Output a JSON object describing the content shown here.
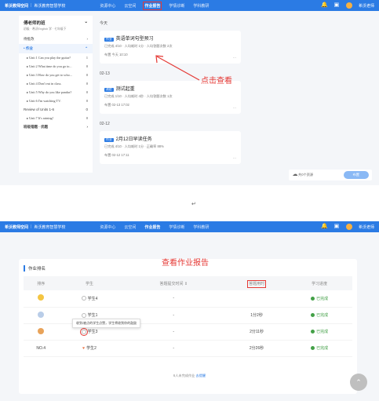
{
  "topbar": {
    "brand": "希沃教师空间",
    "school": "希沃教育智慧学校",
    "nav": [
      "资源中心",
      "云空间",
      "作业报告",
      "学情诊断",
      "学科教研"
    ],
    "user": "希沃老师"
  },
  "sidebar": {
    "title": "傅老师的班",
    "subtitle": "初级 · 希沃English 学 · 七年级下",
    "rows": [
      {
        "label": "待批改",
        "count": "›"
      },
      {
        "label": "作业",
        "count": "⌃"
      },
      {
        "label": "Unit 1 Can you play the guitar?",
        "count": "1"
      },
      {
        "label": "Unit 2 What time do you go to...",
        "count": "0"
      },
      {
        "label": "Unit 3 How do you get to scho...",
        "count": "0"
      },
      {
        "label": "Unit 4 Don't eat in class.",
        "count": "0"
      },
      {
        "label": "Unit 5 Why do you like pandas?",
        "count": "0"
      },
      {
        "label": "Unit 6 I'm watching TV.",
        "count": "0"
      },
      {
        "label": "Review of Units 1-6",
        "count": "0"
      },
      {
        "label": "Unit 7 It's raining!",
        "count": "0"
      },
      {
        "label": "班级错题 · 优题",
        "count": "›"
      }
    ]
  },
  "timeline": [
    {
      "date": "今天",
      "tag": "作业",
      "title": "英语单词句型预习",
      "meta": "已完成 4/10 · 人均耗时 1分 · 人均答题次数 2次",
      "time": "布置 今天 10:10"
    },
    {
      "date": "02-13",
      "tag": "测验",
      "title": "测试起重",
      "meta": "已完成 1/10 · 人均耗时 4秒 · 人均答题次数 1次",
      "time": "布置 02-13 17:02"
    },
    {
      "date": "02-12",
      "tag": "作业",
      "title": "2月12日早读任务",
      "meta": "已完成 4/10 · 人均耗时 1分 · 正确率 88%",
      "time": "布置 02-12 17:11"
    }
  ],
  "annotations": {
    "click_to_view": "点击查看",
    "view_report": "查看作业报告"
  },
  "share": {
    "label": "共0个资源",
    "button": "布置"
  },
  "mid_mark": "↵",
  "ranking": {
    "title": "作业排名",
    "headers": [
      "排序",
      "学生",
      "答题提交时间 ⇕",
      "答题用时",
      "学习进度"
    ],
    "rows": [
      {
        "rank": "gold",
        "student": "学生4",
        "submit": "-",
        "duration": "",
        "status": "已完成"
      },
      {
        "rank": "silver",
        "student": "学生1",
        "submit": "-",
        "duration": "1分2秒",
        "status": "已完成"
      },
      {
        "rank": "bronze",
        "student": "学生3",
        "submit": "-",
        "duration": "2分11秒",
        "status": "已完成"
      },
      {
        "rank": "NO.4",
        "student": "学生2",
        "submit": "-",
        "duration": "2分26秒",
        "status": "已完成"
      }
    ],
    "tooltip": "收到/被点的学生点赞，学生将收到你的鼓励",
    "footer_text": "6人未完成作业",
    "footer_link": "去提醒"
  },
  "colors": {
    "primary": "#2b7be4",
    "annotation": "#e53935",
    "success": "#43a047"
  }
}
